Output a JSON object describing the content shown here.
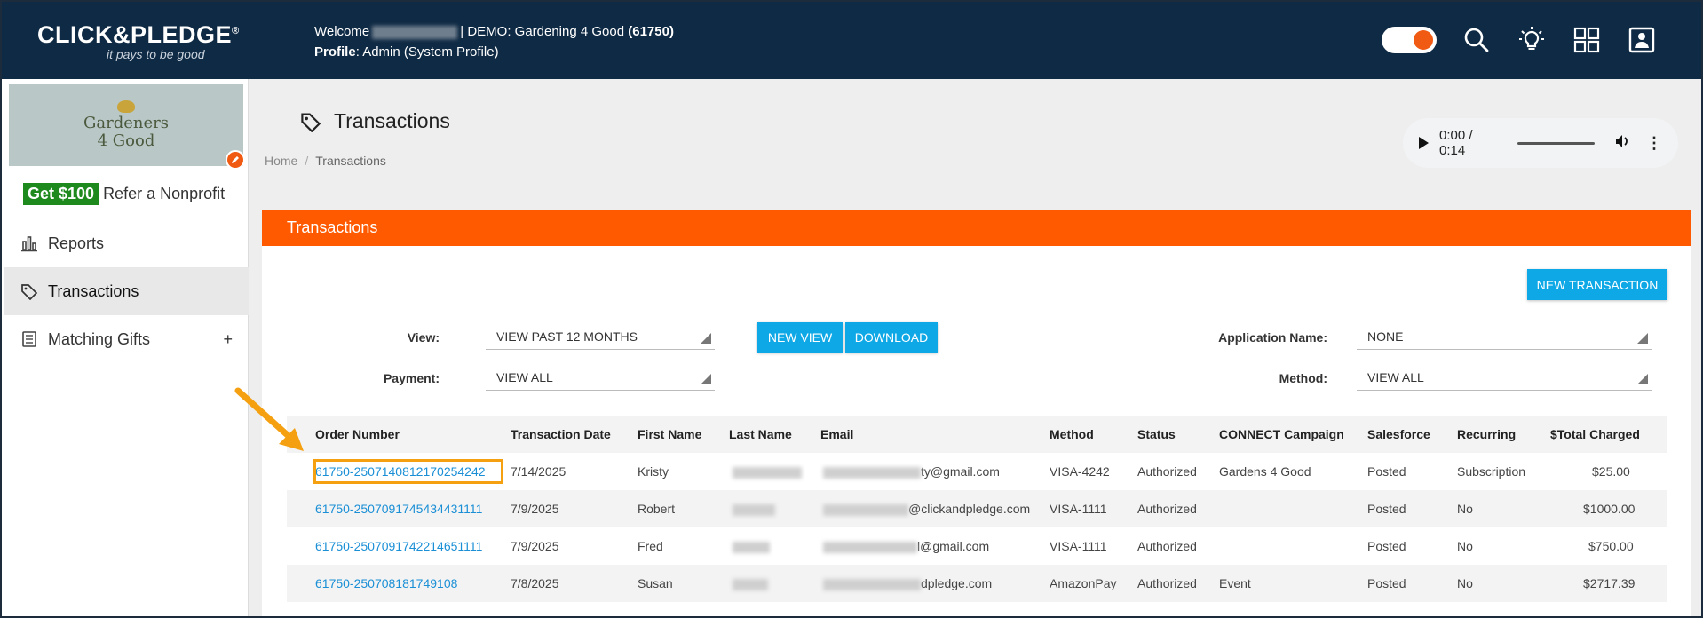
{
  "header": {
    "brand": "CLICK&PLEDGE",
    "brand_reg": "®",
    "tagline": "it pays to be good",
    "welcome_prefix": "Welcome",
    "welcome_suffix": "| DEMO: Gardening 4 Good",
    "account_id": "(61750)",
    "profile_label": "Profile",
    "profile_value": ": Admin (System Profile)"
  },
  "sidebar": {
    "org_line1": "Gardeners",
    "org_line2": "4 Good",
    "refer_badge": "Get $100",
    "refer_text": "Refer a Nonprofit",
    "items": [
      {
        "label": "Reports",
        "icon": "bar-chart-icon"
      },
      {
        "label": "Transactions",
        "icon": "tag-icon"
      },
      {
        "label": "Matching Gifts",
        "icon": "list-icon",
        "expand": "+"
      }
    ]
  },
  "page": {
    "title": "Transactions",
    "breadcrumb_home": "Home",
    "breadcrumb_sep": "/",
    "breadcrumb_current": "Transactions",
    "audio_time": "0:00 / 0:14",
    "audio_more": "⋮"
  },
  "panel": {
    "title": "Transactions",
    "new_transaction": "NEW TRANSACTION",
    "new_view": "NEW VIEW",
    "download": "DOWNLOAD",
    "filters": {
      "view_label": "View:",
      "view_value": "VIEW PAST 12 MONTHS",
      "payment_label": "Payment:",
      "payment_value": "VIEW ALL",
      "app_label": "Application Name:",
      "app_value": "NONE",
      "method_label": "Method:",
      "method_value": "VIEW ALL"
    }
  },
  "table": {
    "columns": [
      "Order Number",
      "Transaction Date",
      "First Name",
      "Last Name",
      "Email",
      "Method",
      "Status",
      "CONNECT Campaign",
      "Salesforce",
      "Recurring",
      "$Total Charged"
    ],
    "rows": [
      {
        "order": "61750-2507140812170254242",
        "date": "7/14/2025",
        "first": "Kristy",
        "email_tail": "ty@gmail.com",
        "method": "VISA-4242",
        "status": "Authorized",
        "campaign": "Gardens 4 Good",
        "salesforce": "Posted",
        "recurring": "Subscription",
        "total": "$25.00"
      },
      {
        "order": "61750-2507091745434431111",
        "date": "7/9/2025",
        "first": "Robert",
        "email_tail": "@clickandpledge.com",
        "method": "VISA-1111",
        "status": "Authorized",
        "campaign": "",
        "salesforce": "Posted",
        "recurring": "No",
        "total": "$1000.00"
      },
      {
        "order": "61750-2507091742214651111",
        "date": "7/9/2025",
        "first": "Fred",
        "email_tail": "l@gmail.com",
        "method": "VISA-1111",
        "status": "Authorized",
        "campaign": "",
        "salesforce": "Posted",
        "recurring": "No",
        "total": "$750.00"
      },
      {
        "order": "61750-250708181749108",
        "date": "7/8/2025",
        "first": "Susan",
        "email_tail": "dpledge.com",
        "method": "AmazonPay",
        "status": "Authorized",
        "campaign": "Event",
        "salesforce": "Posted",
        "recurring": "No",
        "total": "$2717.39"
      }
    ]
  },
  "colors": {
    "header_bg": "#0f2a44",
    "accent_orange": "#ff5a00",
    "button_blue": "#0fa8e6",
    "link_blue": "#1a8fd6",
    "highlight": "#f5a011"
  }
}
